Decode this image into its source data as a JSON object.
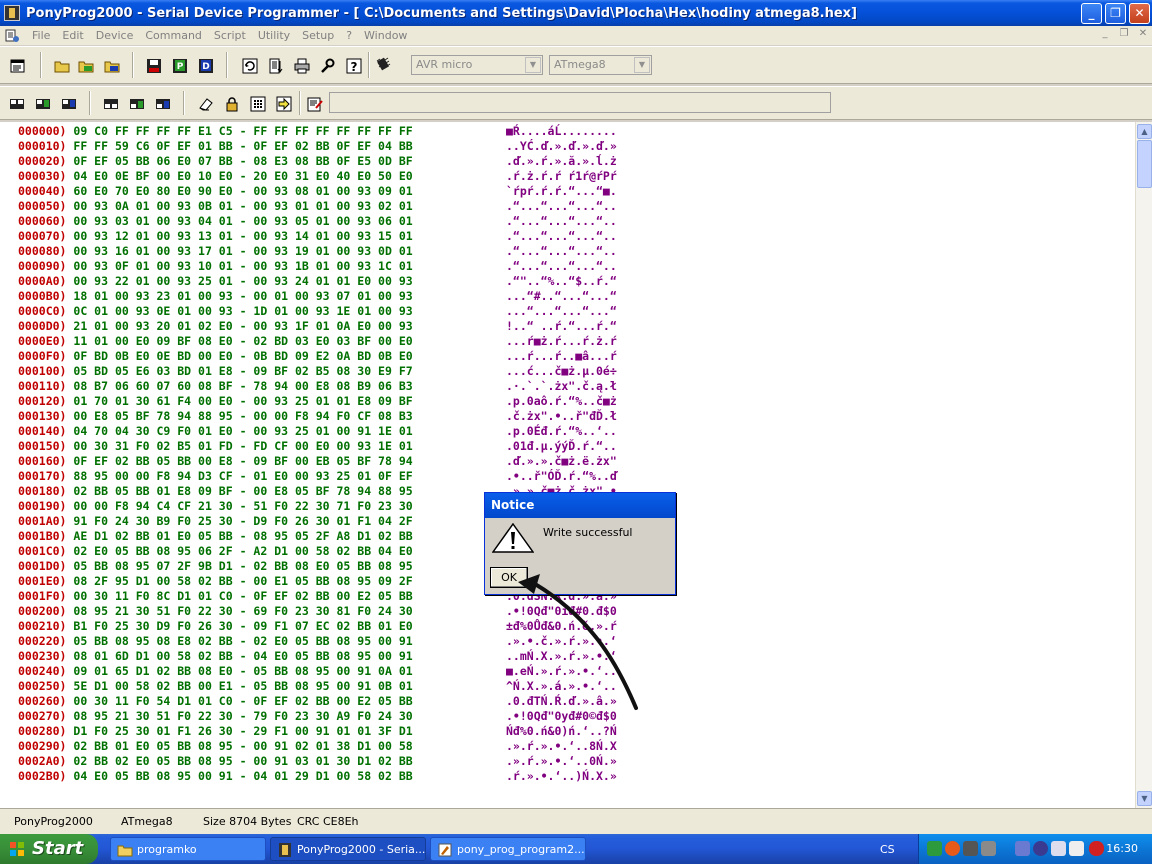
{
  "window": {
    "title": "PonyProg2000 - Serial Device Programmer - [ C:\\Documents and Settings\\David\\Plocha\\Hex\\hodiny atmega8.hex]",
    "minimize": "_",
    "maximize": "❐",
    "close": "✕"
  },
  "menu": {
    "items": [
      "File",
      "Edit",
      "Device",
      "Command",
      "Script",
      "Utility",
      "Setup",
      "?",
      "Window"
    ],
    "mdi_min": "_",
    "mdi_restore": "❐",
    "mdi_close": "✕"
  },
  "toolbar": {
    "family_combo": "AVR micro",
    "device_combo": "ATmega8",
    "combo_arrow": "▼",
    "script_field": ""
  },
  "hex_rows": [
    {
      "addr": "000000)",
      "bytes": "09 C0 FF FF FF FF E1 C5 - FF FF FF FF FF FF FF FF",
      "ascii": "■Ŕ....áĹ........"
    },
    {
      "addr": "000010)",
      "bytes": "FF FF 59 C6 0F EF 01 BB - 0F EF 02 BB 0F EF 04 BB",
      "ascii": "..YĆ.ď.».ď.».ď.»"
    },
    {
      "addr": "000020)",
      "bytes": "0F EF 05 BB 06 E0 07 BB - 08 E3 08 BB 0F E5 0D BF",
      "ascii": ".ď.».ŕ.».ă.».ĺ.ż"
    },
    {
      "addr": "000030)",
      "bytes": "04 E0 0E BF 00 E0 10 E0 - 20 E0 31 E0 40 E0 50 E0",
      "ascii": ".ŕ.ż.ŕ.ŕ ŕ1ŕ@ŕPŕ"
    },
    {
      "addr": "000040)",
      "bytes": "60 E0 70 E0 80 E0 90 E0 - 00 93 08 01 00 93 09 01",
      "ascii": "`ŕpŕ.ŕ.ŕ.“...“■."
    },
    {
      "addr": "000050)",
      "bytes": "00 93 0A 01 00 93 0B 01 - 00 93 01 01 00 93 02 01",
      "ascii": ".“...“...“...“.."
    },
    {
      "addr": "000060)",
      "bytes": "00 93 03 01 00 93 04 01 - 00 93 05 01 00 93 06 01",
      "ascii": ".“...“...“...“.."
    },
    {
      "addr": "000070)",
      "bytes": "00 93 12 01 00 93 13 01 - 00 93 14 01 00 93 15 01",
      "ascii": ".“...“...“...“.."
    },
    {
      "addr": "000080)",
      "bytes": "00 93 16 01 00 93 17 01 - 00 93 19 01 00 93 0D 01",
      "ascii": ".“...“...“...“.."
    },
    {
      "addr": "000090)",
      "bytes": "00 93 0F 01 00 93 10 01 - 00 93 1B 01 00 93 1C 01",
      "ascii": ".“...“...“...“.."
    },
    {
      "addr": "0000A0)",
      "bytes": "00 93 22 01 00 93 25 01 - 00 93 24 01 01 E0 00 93",
      "ascii": ".“\"..“%..“$..ŕ.“"
    },
    {
      "addr": "0000B0)",
      "bytes": "18 01 00 93 23 01 00 93 - 00 01 00 93 07 01 00 93",
      "ascii": "...“#..“...“...“"
    },
    {
      "addr": "0000C0)",
      "bytes": "0C 01 00 93 0E 01 00 93 - 1D 01 00 93 1E 01 00 93",
      "ascii": "...“...“...“...“"
    },
    {
      "addr": "0000D0)",
      "bytes": "21 01 00 93 20 01 02 E0 - 00 93 1F 01 0A E0 00 93",
      "ascii": "!..“ ..ŕ.“...ŕ.“"
    },
    {
      "addr": "0000E0)",
      "bytes": "11 01 00 E0 09 BF 08 E0 - 02 BD 03 E0 03 BF 00 E0",
      "ascii": "...ŕ■ż.ŕ...ŕ.ż.ŕ"
    },
    {
      "addr": "0000F0)",
      "bytes": "0F BD 0B E0 0E BD 00 E0 - 0B BD 09 E2 0A BD 0B E0",
      "ascii": "...ŕ...ŕ..■â...ŕ"
    },
    {
      "addr": "000100)",
      "bytes": "05 BD 05 E6 03 BD 01 E8 - 09 BF 02 B5 08 30 E9 F7",
      "ascii": "...ć...č■ż.µ.0é÷"
    },
    {
      "addr": "000110)",
      "bytes": "08 B7 06 60 07 60 08 BF - 78 94 00 E8 08 B9 06 B3",
      "ascii": ".·.`.`.żx\".č.ą.ł"
    },
    {
      "addr": "000120)",
      "bytes": "01 70 01 30 61 F4 00 E0 - 00 93 25 01 01 E8 09 BF",
      "ascii": ".p.0aô.ŕ.“%..č■ż"
    },
    {
      "addr": "000130)",
      "bytes": "00 E8 05 BF 78 94 88 95 - 00 00 F8 94 F0 CF 08 B3",
      "ascii": ".č.żx\".•..ř\"đĎ.ł"
    },
    {
      "addr": "000140)",
      "bytes": "04 70 04 30 C9 F0 01 E0 - 00 93 25 01 00 91 1E 01",
      "ascii": ".p.0Éđ.ŕ.“%..‘.."
    },
    {
      "addr": "000150)",
      "bytes": "00 30 31 F0 02 B5 01 FD - FD CF 00 E0 00 93 1E 01",
      "ascii": ".01đ.µ.ýýĎ.ŕ.“.."
    },
    {
      "addr": "000160)",
      "bytes": "0F EF 02 BB 05 BB 00 E8 - 09 BF 00 EB 05 BF 78 94",
      "ascii": ".ď.».».č■ż.ë.żx\""
    },
    {
      "addr": "000170)",
      "bytes": "88 95 00 00 F8 94 D3 CF - 01 E0 00 93 25 01 0F EF",
      "ascii": ".•..ř\"ÓĎ.ŕ.“%..ď"
    },
    {
      "addr": "000180)",
      "bytes": "02 BB 05 BB 01 E8 09 BF - 00 E8 05 BF 78 94 88 95",
      "ascii": ".».».č■ż.č.żx\".•"
    },
    {
      "addr": "000190)",
      "bytes": "00 00 F8 94 C4 CF 21 30 - 51 F0 22 30 71 F0 23 30",
      "ascii": "..ř\"ÄĎ!0Qđ\"0qđ#0"
    },
    {
      "addr": "0001A0)",
      "bytes": "91 F0 24 30 B9 F0 25 30 - D9 F0 26 30 01 F1 04 2F",
      "ascii": "‘đ$0ąđ%0Ůđ&0.ń./"
    },
    {
      "addr": "0001B0)",
      "bytes": "AE D1 02 BB 01 E0 05 BB - 08 95 05 2F A8 D1 02 BB",
      "ascii": "®Ń.».ŕ.».•./¨Ń.»"
    },
    {
      "addr": "0001C0)",
      "bytes": "02 E0 05 BB 08 95 06 2F - A2 D1 00 58 02 BB 04 E0",
      "ascii": ".ŕ.».•./˘Ń.X.».ŕ"
    },
    {
      "addr": "0001D0)",
      "bytes": "05 BB 08 95 07 2F 9B D1 - 02 BB 08 E0 05 BB 08 95",
      "ascii": ".».•./›Ń.».ŕ.».•"
    },
    {
      "addr": "0001E0)",
      "bytes": "08 2F 95 D1 00 58 02 BB - 00 E1 05 BB 08 95 09 2F",
      "ascii": "./•Ń.X.».á.».•./"
    },
    {
      "addr": "0001F0)",
      "bytes": "00 30 11 F0 8C D1 01 C0 - 0F EF 02 BB 00 E2 05 BB",
      "ascii": ".0.đŚŃ.Ŕ.ď.».â.»"
    },
    {
      "addr": "000200)",
      "bytes": "08 95 21 30 51 F0 22 30 - 69 F0 23 30 81 F0 24 30",
      "ascii": ".•!0Qđ\"0iđ#0.đ$0"
    },
    {
      "addr": "000210)",
      "bytes": "B1 F0 25 30 D9 F0 26 30 - 09 F1 07 EC 02 BB 01 E0",
      "ascii": "±đ%0Ůđ&0.ń.ě.».ŕ"
    },
    {
      "addr": "000220)",
      "bytes": "05 BB 08 95 08 E8 02 BB - 02 E0 05 BB 08 95 00 91",
      "ascii": ".».•.č.».ŕ.».•.‘"
    },
    {
      "addr": "000230)",
      "bytes": "08 01 6D D1 00 58 02 BB - 04 E0 05 BB 08 95 00 91",
      "ascii": "..mŃ.X.».ŕ.».•.‘"
    },
    {
      "addr": "000240)",
      "bytes": "09 01 65 D1 02 BB 08 E0 - 05 BB 08 95 00 91 0A 01",
      "ascii": "■.eŃ.».ŕ.».•.‘.."
    },
    {
      "addr": "000250)",
      "bytes": "5E D1 00 58 02 BB 00 E1 - 05 BB 08 95 00 91 0B 01",
      "ascii": "^Ń.X.».á.».•.‘.."
    },
    {
      "addr": "000260)",
      "bytes": "00 30 11 F0 54 D1 01 C0 - 0F EF 02 BB 00 E2 05 BB",
      "ascii": ".0.đTŃ.Ŕ.ď.».â.»"
    },
    {
      "addr": "000270)",
      "bytes": "08 95 21 30 51 F0 22 30 - 79 F0 23 30 A9 F0 24 30",
      "ascii": ".•!0Qđ\"0yđ#0©đ$0"
    },
    {
      "addr": "000280)",
      "bytes": "D1 F0 25 30 01 F1 26 30 - 29 F1 00 91 01 01 3F D1",
      "ascii": "Ńđ%0.ń&0)ń.‘..?Ń"
    },
    {
      "addr": "000290)",
      "bytes": "02 BB 01 E0 05 BB 08 95 - 00 91 02 01 38 D1 00 58",
      "ascii": ".».ŕ.».•.‘..8Ń.X"
    },
    {
      "addr": "0002A0)",
      "bytes": "02 BB 02 E0 05 BB 08 95 - 00 91 03 01 30 D1 02 BB",
      "ascii": ".».ŕ.».•.‘..0Ń.»"
    },
    {
      "addr": "0002B0)",
      "bytes": "04 E0 05 BB 08 95 00 91 - 04 01 29 D1 00 58 02 BB",
      "ascii": ".ŕ.».•.‘..)Ń.X.»"
    }
  ],
  "scrollbar": {
    "up": "▲",
    "down": "▼"
  },
  "statusbar": {
    "app": "PonyProg2000",
    "device": "ATmega8",
    "size": "Size  8704 Bytes",
    "crc": "CRC  CE8Eh"
  },
  "dialog": {
    "title": "Notice",
    "message": "Write successful",
    "ok_label": "OK"
  },
  "taskbar": {
    "start_label": "Start",
    "tasks": [
      "programko",
      "PonyProg2000 - Seria...",
      "pony_prog_program2..."
    ],
    "language": "CS",
    "clock": "16:30"
  }
}
